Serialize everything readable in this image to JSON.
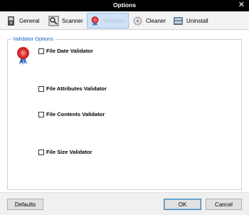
{
  "window": {
    "title": "Options",
    "close_glyph": "✕"
  },
  "toolbar": {
    "tabs": [
      {
        "label": "General",
        "icon": "general-icon"
      },
      {
        "label": "Scanner",
        "icon": "scanner-icon"
      },
      {
        "label": "Validator",
        "icon": "validator-icon",
        "active": true
      },
      {
        "label": "Cleaner",
        "icon": "cleaner-icon"
      },
      {
        "label": "Uninstall",
        "icon": "uninstall-icon"
      }
    ]
  },
  "validator": {
    "group_title": "Validator Options",
    "options": [
      {
        "label": "File Date Validator",
        "checked": false
      },
      {
        "label": "File Attributes Validator",
        "checked": false
      },
      {
        "label": "File Contents Validator",
        "checked": false
      },
      {
        "label": "File Size Validator",
        "checked": false
      }
    ]
  },
  "footer": {
    "defaults_label": "Defaults",
    "ok_label": "OK",
    "cancel_label": "Cancel"
  },
  "colors": {
    "accent": "#1c63c6",
    "active_tab": "#cfe3f7",
    "seal_red": "#d22b2b"
  }
}
